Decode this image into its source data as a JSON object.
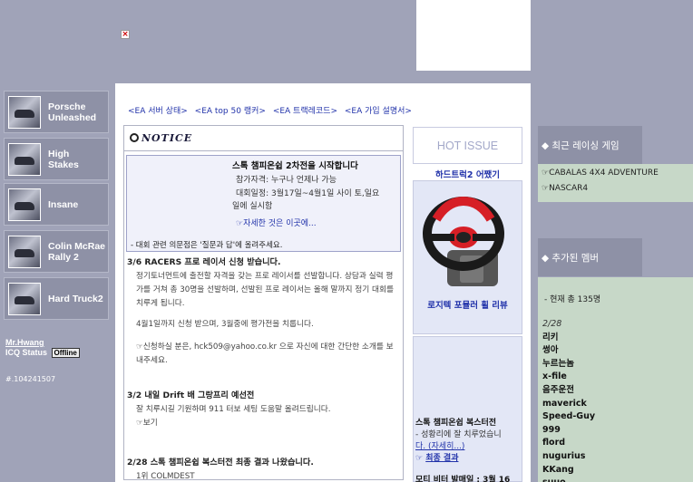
{
  "broken_image": "x-icon",
  "games": [
    {
      "label_l1": "Porsche",
      "label_l2": "Unleashed"
    },
    {
      "label_l1": "High",
      "label_l2": "Stakes"
    },
    {
      "label_l1": "Insane",
      "label_l2": ""
    },
    {
      "label_l1": "Colin McRae",
      "label_l2": "Rally 2"
    },
    {
      "label_l1": "Hard Truck2",
      "label_l2": ""
    }
  ],
  "profile": {
    "name": "Mr.Hwang",
    "icq_label": "ICQ Status",
    "status": "Offline",
    "icq_number": "#.104241507"
  },
  "nav_links": [
    "<EA 서버 상태>",
    "<EA top 50 랭커>",
    "<EA 트랙레코드>",
    "<EA 가입 설명서>"
  ],
  "notice": {
    "title": "NOTICE",
    "box": {
      "title": "스톡 챔피온쉽 2차전을 시작합니다",
      "line1": "참가자격: 누구나 언제나 가능",
      "line2": "대회일정: 3월17일~4월1일 사이 토,일요",
      "line3": "일에 실시함",
      "link": "자세한 것은 이곳에...",
      "footer": "- 대회 관련 의문점은 '질문과 답'에 올려주세요."
    },
    "post1": {
      "title": "3/6 RACERS 프로 레이서 신청 받습니다.",
      "body1": "정기토너먼트에 출전할 자격을 갖는 프로 레이서를 선발합니다. 상담과 실력 평가를 거쳐 총 30명을 선발하며, 선발된 프로 레이서는 올해 말까지 정기 대회를 치루게 됩니다.",
      "body2": "4월1일까지 신청 받으며, 3월중에 평가전을 치룹니다.",
      "body3": "신청하실 분은, hck509@yahoo.co.kr 으로 자신에 대한 간단한 소개를 보내주세요."
    },
    "post2": {
      "title": "3/2 내일 Drift 배 그랑프리 예선전",
      "body": "잘 치루시길 기원하며 911 터보 세팅 도움말 올려드립니다.",
      "link": "보기"
    },
    "post3": {
      "title": "2/28 스톡 챔피온쉽 복스터전 최종 결과 나왔습니다.",
      "body": "1위 COLMDEST"
    }
  },
  "hot_issue": {
    "header": "HOT ISSUE",
    "item1_title": "하드트럭2 어쨌기",
    "item1_caption": "로지텍 포뮬러 휠 리뷰",
    "item2_title": "스톡 챔피온쉽 복스터전",
    "item2_line": "- 성황리에 잘 치루었습니",
    "item2_more": "다. (자세히...)",
    "item2_link": "최종 결과",
    "item3_title": "모티 비터 발매일 : 3월 16"
  },
  "recent_games": {
    "title": "◆ 최근 레이싱 게임",
    "items": [
      "CABALAS 4X4 ADVENTURE",
      "NASCAR4"
    ]
  },
  "members": {
    "title": "◆ 추가된 멤버",
    "count": "- 현재 총 135명",
    "date": "2/28",
    "names": [
      "리키",
      "썽아",
      "누르는놈",
      "x-file",
      "음주운전",
      "maverick",
      "Speed-Guy",
      "999",
      "flord",
      "nugurius",
      "KKang",
      "suuo"
    ]
  },
  "colors": {
    "background": "#a0a3b8",
    "panel": "#8e91a6",
    "green_panel": "#c7d8c8",
    "link": "#2233aa"
  }
}
